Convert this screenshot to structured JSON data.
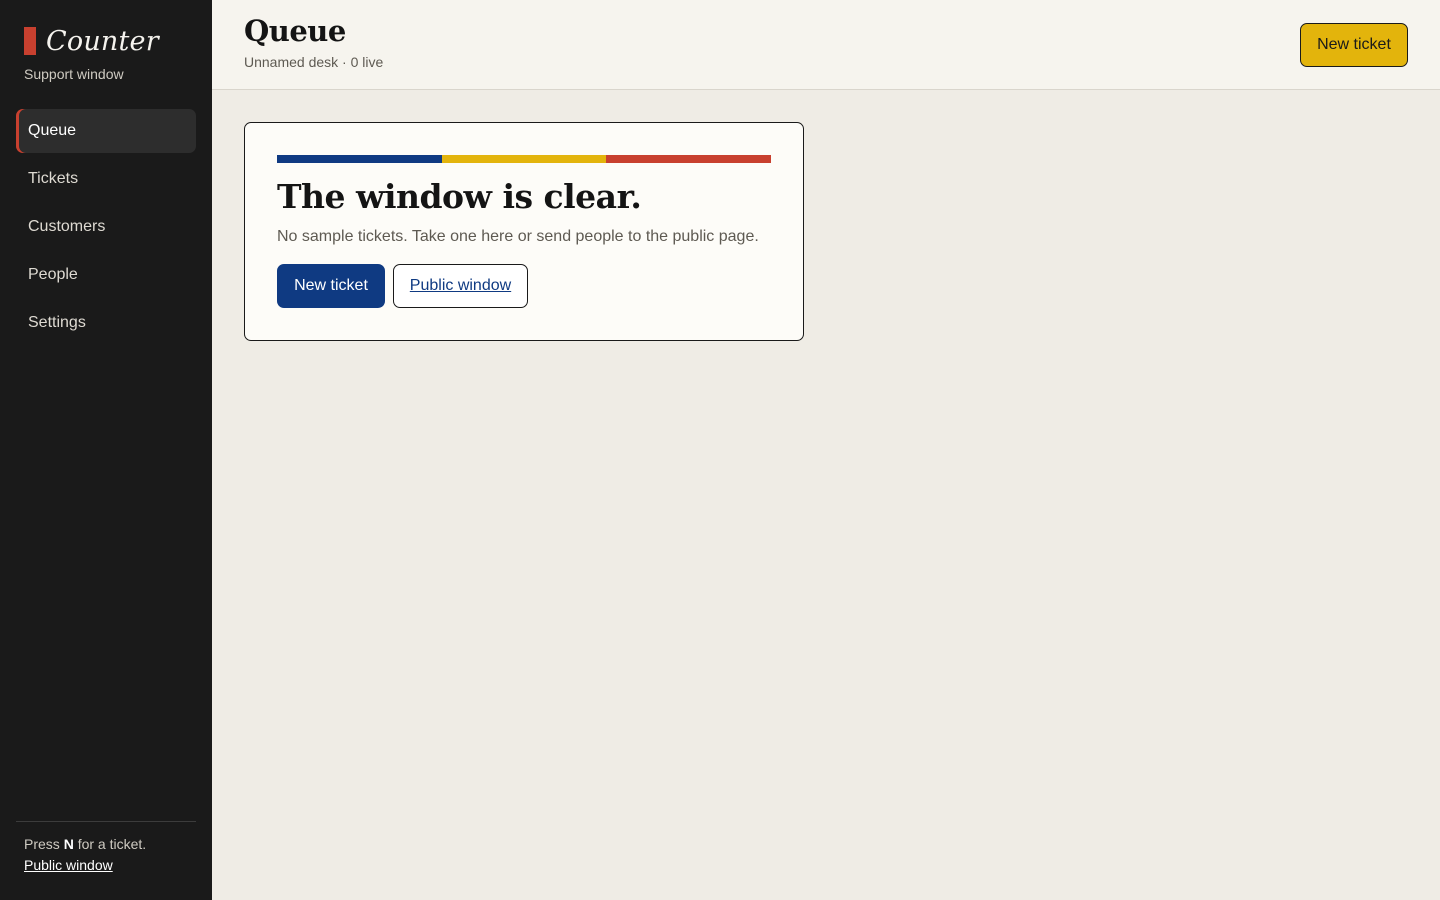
{
  "brand": {
    "name": "Counter",
    "subtitle": "Support window",
    "accent": "#c8402f"
  },
  "nav": {
    "items": [
      {
        "label": "Queue",
        "active": true
      },
      {
        "label": "Tickets",
        "active": false
      },
      {
        "label": "Customers",
        "active": false
      },
      {
        "label": "People",
        "active": false
      },
      {
        "label": "Settings",
        "active": false
      }
    ]
  },
  "sidebar_footer": {
    "hint_prefix": "Press",
    "hint_key": "N",
    "hint_suffix": "for a ticket.",
    "link_label": "Public window"
  },
  "header": {
    "title": "Queue",
    "subtitle": "Unnamed desk · 0 live",
    "new_ticket_label": "New ticket"
  },
  "empty_state": {
    "title": "The window is clear.",
    "text": "No sample tickets. Take one here or send people to the public page.",
    "primary_label": "New ticket",
    "secondary_label": "Public window",
    "stripe_colors": [
      "#0f3a82",
      "#e3b40c",
      "#c8402f"
    ]
  },
  "colors": {
    "sidebar_bg": "#1a1a1a",
    "page_bg": "#efece5",
    "primary": "#0f3a82",
    "highlight": "#e3b40c",
    "accent": "#c8402f"
  }
}
